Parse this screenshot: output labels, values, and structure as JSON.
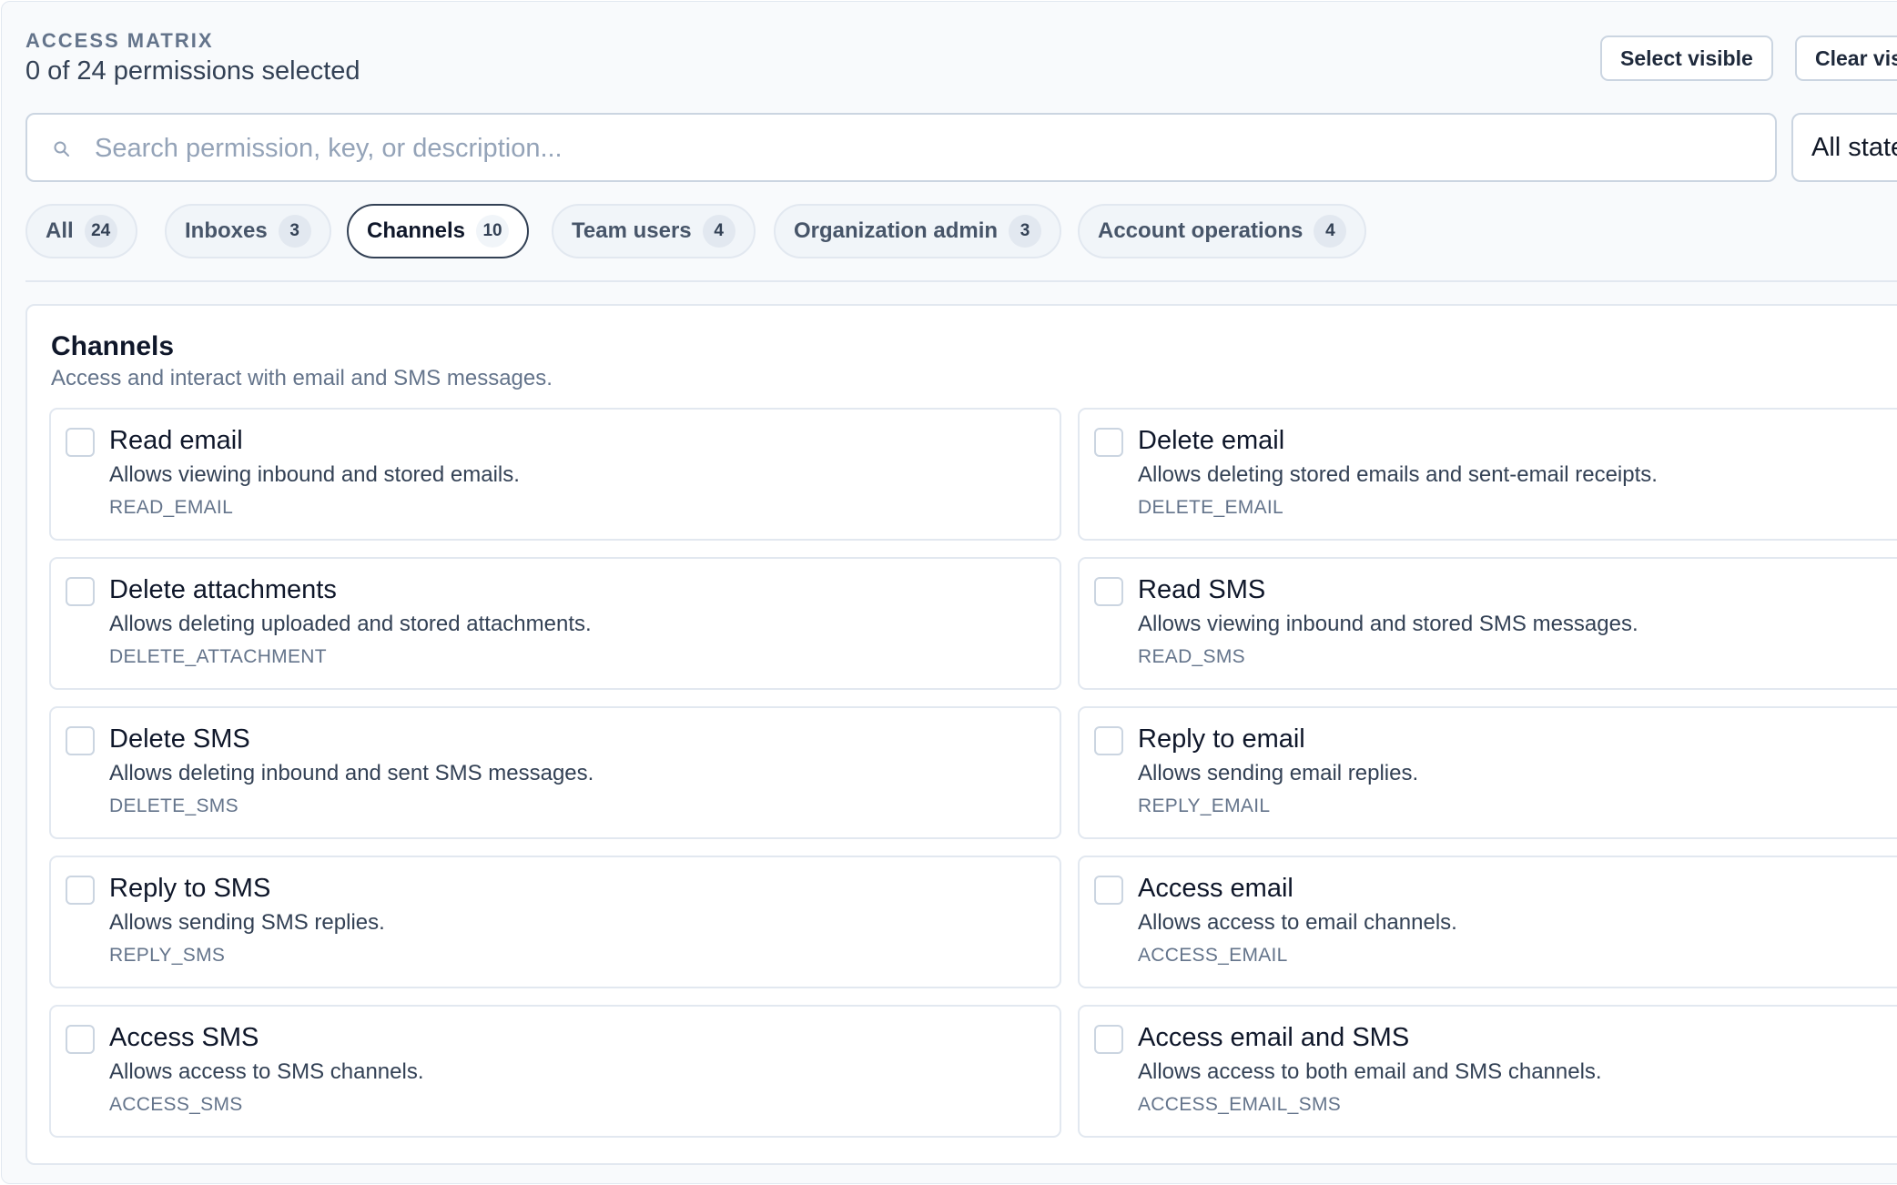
{
  "header": {
    "eyebrow": "ACCESS MATRIX",
    "selection_summary": "0 of 24 permissions selected",
    "select_visible_label": "Select visible",
    "clear_visible_label": "Clear vis"
  },
  "search": {
    "placeholder": "Search permission, key, or description...",
    "value": "",
    "icon": "search-icon"
  },
  "state_filter": {
    "selected": "All state"
  },
  "tabs": [
    {
      "label": "All",
      "count": "24",
      "active": false
    },
    {
      "label": "Inboxes",
      "count": "3",
      "active": false
    },
    {
      "label": "Channels",
      "count": "10",
      "active": true
    },
    {
      "label": "Team users",
      "count": "4",
      "active": false
    },
    {
      "label": "Organization admin",
      "count": "3",
      "active": false
    },
    {
      "label": "Account operations",
      "count": "4",
      "active": false
    }
  ],
  "section": {
    "title": "Channels",
    "description": "Access and interact with email and SMS messages.",
    "permissions": [
      {
        "name": "Read email",
        "description": "Allows viewing inbound and stored emails.",
        "key": "READ_EMAIL",
        "checked": false
      },
      {
        "name": "Delete email",
        "description": "Allows deleting stored emails and sent-email receipts.",
        "key": "DELETE_EMAIL",
        "checked": false
      },
      {
        "name": "Delete attachments",
        "description": "Allows deleting uploaded and stored attachments.",
        "key": "DELETE_ATTACHMENT",
        "checked": false
      },
      {
        "name": "Read SMS",
        "description": "Allows viewing inbound and stored SMS messages.",
        "key": "READ_SMS",
        "checked": false
      },
      {
        "name": "Delete SMS",
        "description": "Allows deleting inbound and sent SMS messages.",
        "key": "DELETE_SMS",
        "checked": false
      },
      {
        "name": "Reply to email",
        "description": "Allows sending email replies.",
        "key": "REPLY_EMAIL",
        "checked": false
      },
      {
        "name": "Reply to SMS",
        "description": "Allows sending SMS replies.",
        "key": "REPLY_SMS",
        "checked": false
      },
      {
        "name": "Access email",
        "description": "Allows access to email channels.",
        "key": "ACCESS_EMAIL",
        "checked": false
      },
      {
        "name": "Access SMS",
        "description": "Allows access to SMS channels.",
        "key": "ACCESS_SMS",
        "checked": false
      },
      {
        "name": "Access email and SMS",
        "description": "Allows access to both email and SMS channels.",
        "key": "ACCESS_EMAIL_SMS",
        "checked": false
      }
    ]
  }
}
